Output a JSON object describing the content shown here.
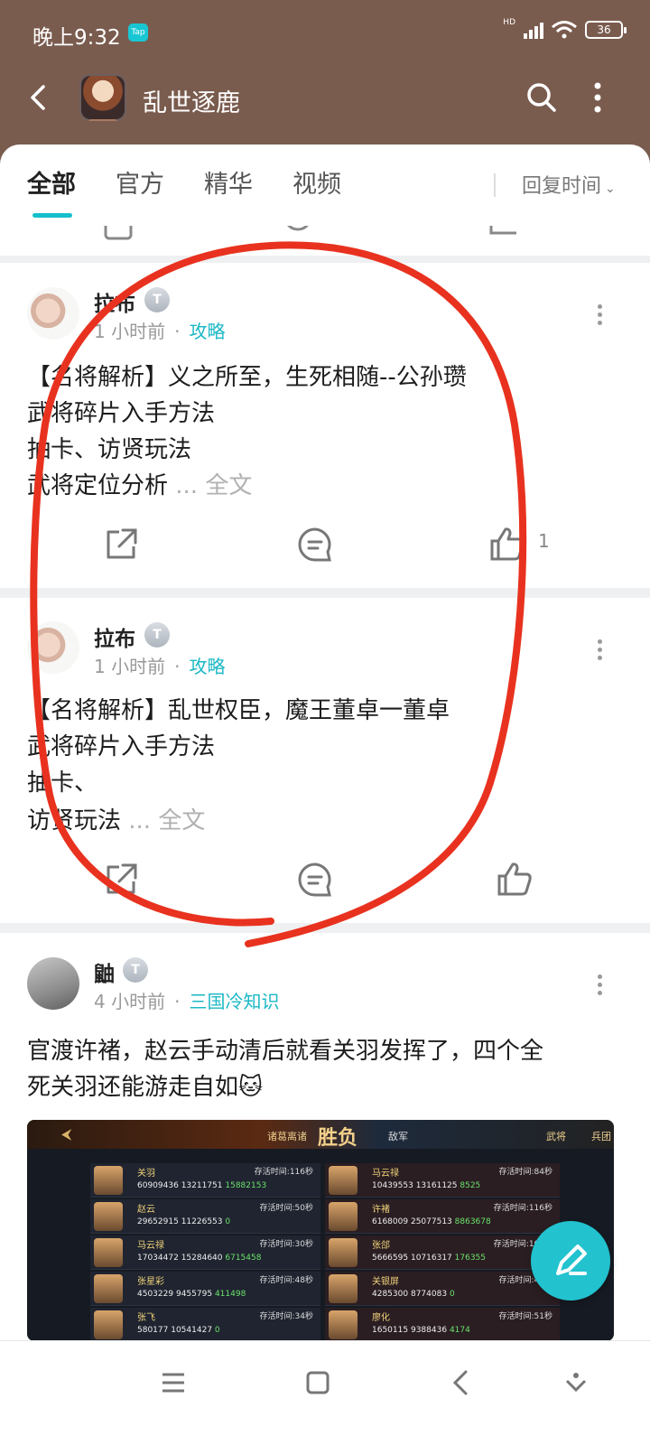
{
  "status_bar": {
    "time": "晚上9:32",
    "tap_badge": "Tap",
    "network": "HD",
    "battery": "36"
  },
  "header": {
    "title": "乱世逐鹿"
  },
  "tabs": [
    {
      "label": "全部",
      "active": true
    },
    {
      "label": "官方",
      "active": false
    },
    {
      "label": "精华",
      "active": false
    },
    {
      "label": "视频",
      "active": false
    }
  ],
  "sort": {
    "label": "回复时间"
  },
  "posts": [
    {
      "username": "拉布",
      "level": "T",
      "time": "1 小时前",
      "category": "攻略",
      "lines": [
        "【名将解析】义之所至，生死相随--公孙瓒",
        "武将碎片入手方法",
        "抽卡、访贤玩法",
        "武将定位分析"
      ],
      "more": "... 全文",
      "like_count": "1"
    },
    {
      "username": "拉布",
      "level": "T",
      "time": "1 小时前",
      "category": "攻略",
      "lines": [
        "【名将解析】乱世权臣，魔王董卓一董卓",
        "武将碎片入手方法",
        "抽卡、",
        "访贤玩法"
      ],
      "more": "... 全文"
    },
    {
      "username": "鼬",
      "level": "T",
      "time": "4 小时前",
      "category": "三国冷知识",
      "lines": [
        "官渡许褚，赵云手动清后就看关羽发挥了，四个全",
        "死关羽还能游走自如🐱"
      ]
    }
  ],
  "game_screenshot": {
    "banner": "胜负",
    "left_team": "诸葛离诸",
    "right_team": "敌军",
    "tabs": [
      "武将",
      "兵团"
    ],
    "left_rows": [
      {
        "name": "关羽",
        "time": "存活时间:116秒",
        "nums": [
          "60909436",
          "13211751",
          "15882153"
        ]
      },
      {
        "name": "赵云",
        "time": "存活时间:50秒",
        "nums": [
          "29652915",
          "11226553",
          "0"
        ]
      },
      {
        "name": "马云禄",
        "time": "存活时间:30秒",
        "nums": [
          "17034472",
          "15284640",
          "6715458"
        ]
      },
      {
        "name": "张星彩",
        "time": "存活时间:48秒",
        "nums": [
          "4503229",
          "9455795",
          "411498"
        ]
      },
      {
        "name": "张飞",
        "time": "存活时间:34秒",
        "nums": [
          "580177",
          "10541427",
          "0"
        ]
      }
    ],
    "right_rows": [
      {
        "name": "马云禄",
        "time": "存活时间:84秒",
        "nums": [
          "10439553",
          "13161125",
          "8525"
        ]
      },
      {
        "name": "许褚",
        "time": "存活时间:116秒",
        "nums": [
          "6168009",
          "25077513",
          "8863678"
        ]
      },
      {
        "name": "张郃",
        "time": "存活时间:104秒",
        "nums": [
          "5666595",
          "10716317",
          "176355"
        ]
      },
      {
        "name": "关银屏",
        "time": "存活时间:47秒",
        "nums": [
          "4285300",
          "8774083",
          "0"
        ]
      },
      {
        "name": "廖化",
        "time": "存活时间:51秒",
        "nums": [
          "1650115",
          "9388436",
          "4174"
        ]
      }
    ]
  },
  "colors": {
    "accent": "#1cb8c6",
    "header_bg": "#7a5c4f",
    "annotation": "#e8321f"
  }
}
